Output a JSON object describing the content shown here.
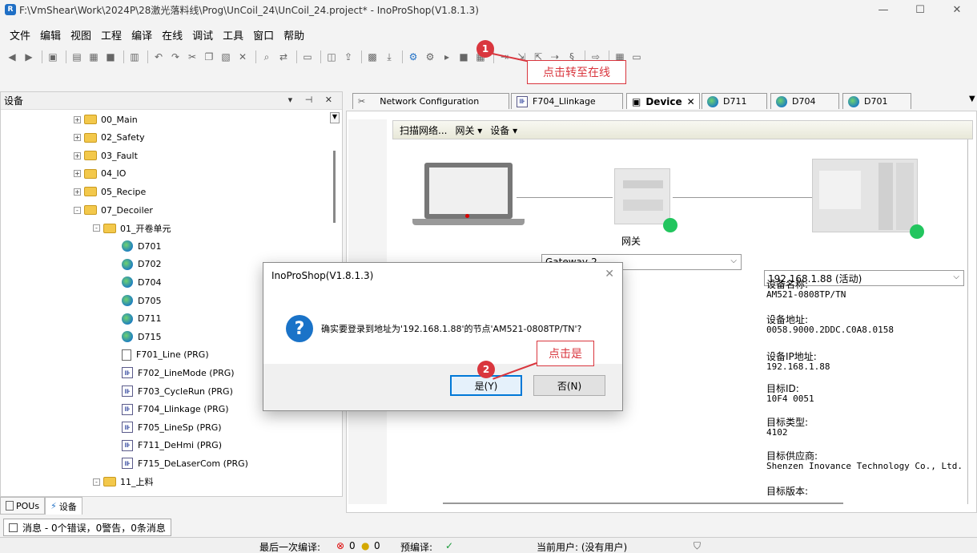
{
  "window": {
    "title": "F:\\VmShear\\Work\\2024P\\28激光落料线\\Prog\\UnCoil_24\\UnCoil_24.project* - InoProShop(V1.8.1.3)"
  },
  "menu": [
    "文件",
    "编辑",
    "视图",
    "工程",
    "编译",
    "在线",
    "调试",
    "工具",
    "窗口",
    "帮助"
  ],
  "devices_panel": {
    "title": "设备",
    "tree": [
      {
        "label": "00_Main",
        "icon": "folder",
        "level": 1,
        "expander": "+"
      },
      {
        "label": "02_Safety",
        "icon": "folder",
        "level": 1,
        "expander": "+"
      },
      {
        "label": "03_Fault",
        "icon": "folder",
        "level": 1,
        "expander": "+"
      },
      {
        "label": "04_IO",
        "icon": "folder",
        "level": 1,
        "expander": "+"
      },
      {
        "label": "05_Recipe",
        "icon": "folder",
        "level": 1,
        "expander": "+"
      },
      {
        "label": "07_Decoiler",
        "icon": "folder",
        "level": 1,
        "expander": "-"
      },
      {
        "label": "01_开卷单元",
        "icon": "folder",
        "level": 2,
        "expander": "-"
      },
      {
        "label": "D701",
        "icon": "globe",
        "level": 3
      },
      {
        "label": "D702",
        "icon": "globe",
        "level": 3
      },
      {
        "label": "D704",
        "icon": "globe",
        "level": 3
      },
      {
        "label": "D705",
        "icon": "globe",
        "level": 3
      },
      {
        "label": "D711",
        "icon": "globe",
        "level": 3
      },
      {
        "label": "D715",
        "icon": "globe",
        "level": 3
      },
      {
        "label": "F701_Line (PRG)",
        "icon": "doc",
        "level": 3
      },
      {
        "label": "F702_LineMode (PRG)",
        "icon": "prg",
        "level": 3
      },
      {
        "label": "F703_CycleRun (PRG)",
        "icon": "prg",
        "level": 3
      },
      {
        "label": "F704_Llinkage (PRG)",
        "icon": "prg",
        "level": 3
      },
      {
        "label": "F705_LineSp (PRG)",
        "icon": "prg",
        "level": 3
      },
      {
        "label": "F711_DeHmi (PRG)",
        "icon": "prg",
        "level": 3
      },
      {
        "label": "F715_DeLaserCom (PRG)",
        "icon": "prg",
        "level": 3
      },
      {
        "label": "11_上料",
        "icon": "folder",
        "level": 2,
        "expander": "-"
      }
    ],
    "bottom_tabs": [
      "POUs",
      "设备"
    ]
  },
  "messages": "消息 - 0个错误，0警告，0条消息",
  "doc_tabs": [
    {
      "label": "Network Configuration",
      "active": false
    },
    {
      "label": "F704_Llinkage",
      "active": false
    },
    {
      "label": "Device",
      "active": true
    },
    {
      "label": "D711",
      "active": false
    },
    {
      "label": "D704",
      "active": false
    },
    {
      "label": "D701",
      "active": false
    }
  ],
  "device_toolbar": {
    "scan": "扫描网络...",
    "gateway": "网关 ▾",
    "device": "设备 ▾"
  },
  "gateway_label": "网关",
  "gateway_select": "Gateway-2",
  "device_select": "192.168.1.88 (活动)",
  "device_info": [
    {
      "label": "设备名称:",
      "value": "AM521-0808TP/TN"
    },
    {
      "label": "设备地址:",
      "value": "0058.9000.2DDC.C0A8.0158"
    },
    {
      "label": "设备IP地址:",
      "value": "192.168.1.88"
    },
    {
      "label": "目标ID:",
      "value": "10F4 0051"
    },
    {
      "label": "目标类型:",
      "value": "4102"
    },
    {
      "label": "目标供应商:",
      "value": "Shenzen Inovance Technology Co., Ltd."
    },
    {
      "label": "目标版本:",
      "value": ""
    }
  ],
  "dialog": {
    "title": "InoProShop(V1.8.1.3)",
    "message": "确实要登录到地址为'192.168.1.88'的节点'AM521-0808TP/TN'?",
    "yes": "是(Y)",
    "no": "否(N)"
  },
  "annotations": [
    {
      "number": "1",
      "text": "点击转至在线"
    },
    {
      "number": "2",
      "text": "点击是"
    }
  ],
  "status": {
    "last_compile_label": "最后一次编译:",
    "errors": "0",
    "warnings": "0",
    "precompile_label": "预编译:",
    "user": "当前用户: (没有用户)"
  },
  "colors": {
    "accent": "#0078d7",
    "annotation": "#d9363e",
    "online": "#22c55e"
  }
}
